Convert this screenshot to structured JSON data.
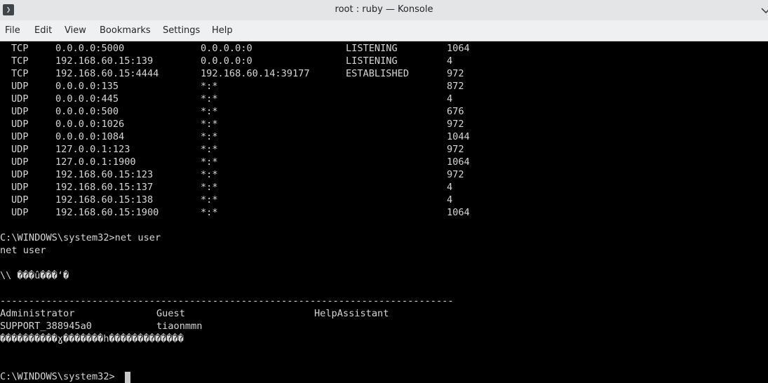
{
  "window": {
    "title": "root : ruby — Konsole",
    "app_icon_glyph": "❯"
  },
  "menu": [
    "File",
    "Edit",
    "View",
    "Bookmarks",
    "Settings",
    "Help"
  ],
  "netstat_rows": [
    {
      "proto": "TCP",
      "local": "0.0.0.0:5000",
      "foreign": "0.0.0.0:0",
      "state": "LISTENING",
      "pid": "1064"
    },
    {
      "proto": "TCP",
      "local": "192.168.60.15:139",
      "foreign": "0.0.0.0:0",
      "state": "LISTENING",
      "pid": "4"
    },
    {
      "proto": "TCP",
      "local": "192.168.60.15:4444",
      "foreign": "192.168.60.14:39177",
      "state": "ESTABLISHED",
      "pid": "972"
    },
    {
      "proto": "UDP",
      "local": "0.0.0.0:135",
      "foreign": "*:*",
      "state": "",
      "pid": "872"
    },
    {
      "proto": "UDP",
      "local": "0.0.0.0:445",
      "foreign": "*:*",
      "state": "",
      "pid": "4"
    },
    {
      "proto": "UDP",
      "local": "0.0.0.0:500",
      "foreign": "*:*",
      "state": "",
      "pid": "676"
    },
    {
      "proto": "UDP",
      "local": "0.0.0.0:1026",
      "foreign": "*:*",
      "state": "",
      "pid": "972"
    },
    {
      "proto": "UDP",
      "local": "0.0.0.0:1084",
      "foreign": "*:*",
      "state": "",
      "pid": "1044"
    },
    {
      "proto": "UDP",
      "local": "127.0.0.1:123",
      "foreign": "*:*",
      "state": "",
      "pid": "972"
    },
    {
      "proto": "UDP",
      "local": "127.0.0.1:1900",
      "foreign": "*:*",
      "state": "",
      "pid": "1064"
    },
    {
      "proto": "UDP",
      "local": "192.168.60.15:123",
      "foreign": "*:*",
      "state": "",
      "pid": "972"
    },
    {
      "proto": "UDP",
      "local": "192.168.60.15:137",
      "foreign": "*:*",
      "state": "",
      "pid": "4"
    },
    {
      "proto": "UDP",
      "local": "192.168.60.15:138",
      "foreign": "*:*",
      "state": "",
      "pid": "4"
    },
    {
      "proto": "UDP",
      "local": "192.168.60.15:1900",
      "foreign": "*:*",
      "state": "",
      "pid": "1064"
    }
  ],
  "session": {
    "prompt_command": "C:\\WINDOWS\\system32>net user",
    "echo": "net user",
    "users_header": "\\\\ ���û���ʻ�",
    "separator": "-------------------------------------------------------------------------------",
    "users_row1": [
      "Administrator",
      "Guest",
      "HelpAssistant"
    ],
    "users_row2": [
      "SUPPORT_388945a0",
      "tiaonmmn"
    ],
    "garbled_status": "����������ɣ�������һ�������������",
    "final_prompt": "C:\\WINDOWS\\system32>"
  },
  "colors": {
    "terminal_bg": "#000000",
    "terminal_fg": "#d6d6d6",
    "titlebar_bg": "#e3e5e7",
    "menubar_bg": "#eff0f1"
  }
}
